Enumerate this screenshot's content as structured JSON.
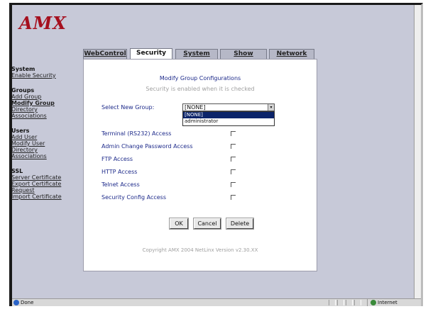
{
  "header": {
    "logo_text": "AMX"
  },
  "tabs": [
    {
      "label": "WebControl",
      "active": false
    },
    {
      "label": "Security",
      "active": true
    },
    {
      "label": "System",
      "active": false
    },
    {
      "label": "Show Devices",
      "active": false
    },
    {
      "label": "Network",
      "active": false
    }
  ],
  "sidebar": {
    "system": {
      "title": "System",
      "items": [
        "Enable Security"
      ]
    },
    "groups": {
      "title": "Groups",
      "items": [
        "Add Group",
        "Modify Group",
        "Directory",
        "Associations"
      ]
    },
    "users": {
      "title": "Users",
      "items": [
        "Add User",
        "Modify User",
        "Directory",
        "Associations"
      ]
    },
    "ssl": {
      "title": "SSL",
      "items": [
        "Server Certificate",
        "Export Certificate",
        "Request",
        "Import Certificate"
      ]
    }
  },
  "panel": {
    "title": "Modify Group Configurations",
    "subtitle": "Security is enabled when it is checked",
    "select_label": "Select New Group:",
    "select_value": "[NONE]",
    "select_arrow": "▾",
    "options": [
      "[NONE]",
      "administrator"
    ],
    "access_rows": [
      "Terminal (RS232) Access",
      "Admin Change Password Access",
      "FTP Access",
      "HTTP Access",
      "Telnet Access",
      "Security Config Access"
    ],
    "buttons": {
      "ok": "OK",
      "cancel": "Cancel",
      "delete": "Delete"
    },
    "copyright": "Copyright AMX 2004   NetLinx Version v2.30.XX"
  },
  "status": {
    "left": "Done",
    "zone": "Internet"
  }
}
